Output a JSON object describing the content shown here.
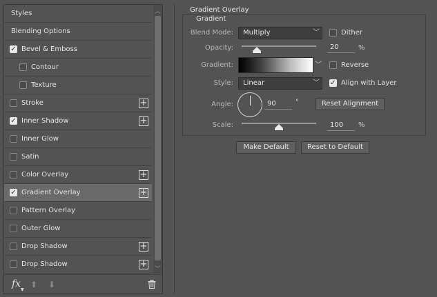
{
  "styles_list": {
    "header": "Styles",
    "blending_options": "Blending Options",
    "items": [
      {
        "label": "Bevel & Emboss",
        "checked": true,
        "sub": false,
        "plus": false,
        "active": false
      },
      {
        "label": "Contour",
        "checked": false,
        "sub": true,
        "plus": false,
        "active": false
      },
      {
        "label": "Texture",
        "checked": false,
        "sub": true,
        "plus": false,
        "active": false
      },
      {
        "label": "Stroke",
        "checked": false,
        "sub": false,
        "plus": true,
        "active": false
      },
      {
        "label": "Inner Shadow",
        "checked": true,
        "sub": false,
        "plus": true,
        "active": false
      },
      {
        "label": "Inner Glow",
        "checked": false,
        "sub": false,
        "plus": false,
        "active": false
      },
      {
        "label": "Satin",
        "checked": false,
        "sub": false,
        "plus": false,
        "active": false
      },
      {
        "label": "Color Overlay",
        "checked": false,
        "sub": false,
        "plus": true,
        "active": false
      },
      {
        "label": "Gradient Overlay",
        "checked": true,
        "sub": false,
        "plus": true,
        "active": true
      },
      {
        "label": "Pattern Overlay",
        "checked": false,
        "sub": false,
        "plus": false,
        "active": false
      },
      {
        "label": "Outer Glow",
        "checked": false,
        "sub": false,
        "plus": false,
        "active": false
      },
      {
        "label": "Drop Shadow",
        "checked": false,
        "sub": false,
        "plus": true,
        "active": false
      },
      {
        "label": "Drop Shadow",
        "checked": false,
        "sub": false,
        "plus": true,
        "active": false
      }
    ]
  },
  "bottom_bar": {
    "fx": "fx"
  },
  "panel": {
    "title": "Gradient Overlay",
    "group_title": "Gradient",
    "blend_mode": {
      "label": "Blend Mode:",
      "value": "Multiply"
    },
    "dither": {
      "label": "Dither",
      "checked": false
    },
    "opacity": {
      "label": "Opacity:",
      "value": "20",
      "unit": "%",
      "level": 0.2
    },
    "gradient": {
      "label": "Gradient:"
    },
    "reverse": {
      "label": "Reverse",
      "checked": false
    },
    "style": {
      "label": "Style:",
      "value": "Linear"
    },
    "align_with_layer": {
      "label": "Align with Layer",
      "checked": true
    },
    "angle": {
      "label": "Angle:",
      "value": "90",
      "unit": "°"
    },
    "reset_alignment": "Reset Alignment",
    "scale": {
      "label": "Scale:",
      "value": "100",
      "unit": "%",
      "level": 0.5
    }
  },
  "buttons": {
    "make_default": "Make Default",
    "reset_to_default": "Reset to Default"
  },
  "colors": {
    "background": "#535353",
    "active_row": "#6a6a6a",
    "input_bg": "#3e3e3e"
  }
}
